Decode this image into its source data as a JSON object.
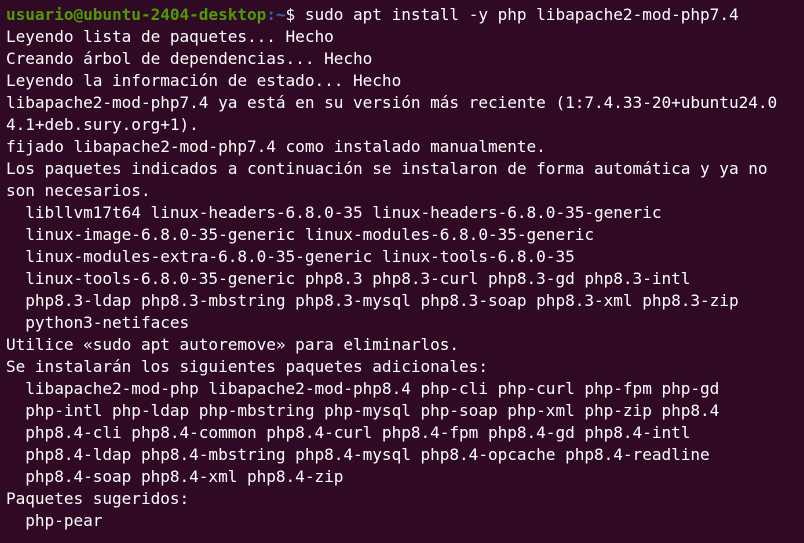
{
  "prompt": {
    "user_host": "usuario@ubuntu-2404-desktop",
    "path": ":~",
    "symbol": "$ ",
    "command": "sudo apt install -y php libapache2-mod-php7.4"
  },
  "output_lines": [
    "Leyendo lista de paquetes... Hecho",
    "Creando árbol de dependencias... Hecho",
    "Leyendo la información de estado... Hecho",
    "libapache2-mod-php7.4 ya está en su versión más reciente (1:7.4.33-20+ubuntu24.0",
    "4.1+deb.sury.org+1).",
    "fijado libapache2-mod-php7.4 como instalado manualmente.",
    "Los paquetes indicados a continuación se instalaron de forma automática y ya no",
    "son necesarios.",
    "  libllvm17t64 linux-headers-6.8.0-35 linux-headers-6.8.0-35-generic",
    "  linux-image-6.8.0-35-generic linux-modules-6.8.0-35-generic",
    "  linux-modules-extra-6.8.0-35-generic linux-tools-6.8.0-35",
    "  linux-tools-6.8.0-35-generic php8.3 php8.3-curl php8.3-gd php8.3-intl",
    "  php8.3-ldap php8.3-mbstring php8.3-mysql php8.3-soap php8.3-xml php8.3-zip",
    "  python3-netifaces",
    "Utilice «sudo apt autoremove» para eliminarlos.",
    "Se instalarán los siguientes paquetes adicionales:",
    "  libapache2-mod-php libapache2-mod-php8.4 php-cli php-curl php-fpm php-gd",
    "  php-intl php-ldap php-mbstring php-mysql php-soap php-xml php-zip php8.4",
    "  php8.4-cli php8.4-common php8.4-curl php8.4-fpm php8.4-gd php8.4-intl",
    "  php8.4-ldap php8.4-mbstring php8.4-mysql php8.4-opcache php8.4-readline",
    "  php8.4-soap php8.4-xml php8.4-zip",
    "Paquetes sugeridos:",
    "  php-pear"
  ],
  "colors": {
    "background": "#300a24",
    "user_host": "#4e9a06",
    "path": "#3465a4",
    "text": "#ffffff"
  }
}
